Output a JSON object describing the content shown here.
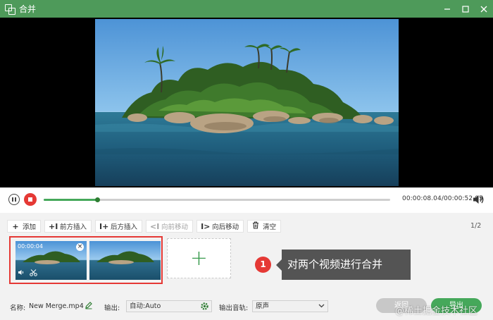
{
  "window": {
    "title": "合并",
    "controls": [
      "minimize-icon",
      "maximize-icon",
      "close-icon"
    ]
  },
  "player": {
    "timecode": "00:00:08.04/00:00:52.05",
    "progress_fraction": 0.155
  },
  "toolbar": {
    "buttons": [
      {
        "icon": "plus-icon",
        "label": "添加",
        "enabled": true
      },
      {
        "icon": "insert-before-icon",
        "label": "前方插入",
        "enabled": true
      },
      {
        "icon": "insert-after-icon",
        "label": "后方插入",
        "enabled": true
      },
      {
        "icon": "move-forward-icon",
        "label": "向前移动",
        "enabled": false
      },
      {
        "icon": "move-backward-icon",
        "label": "向后移动",
        "enabled": true
      },
      {
        "icon": "trash-icon",
        "label": "清空",
        "enabled": true
      }
    ],
    "page_counter": "1/2"
  },
  "clips": [
    {
      "duration": "00:00:04",
      "selected": true
    },
    {
      "duration": "",
      "selected": false
    }
  ],
  "annotation": {
    "step": "1",
    "text": "对两个视频进行合并"
  },
  "bottom": {
    "name_label": "名称:",
    "name_value": "New Merge.mp4",
    "output_label": "输出:",
    "output_value": "自动:Auto",
    "audio_label": "输出音轨:",
    "audio_value": "原声",
    "back_label": "返回",
    "export_label": "导出"
  },
  "watermark": "@稀土掘金技术社区",
  "colors": {
    "titlebar": "#4e9a5a",
    "accent_green": "#45a85a",
    "highlight_red": "#e53935",
    "callout_bg": "#545454"
  }
}
